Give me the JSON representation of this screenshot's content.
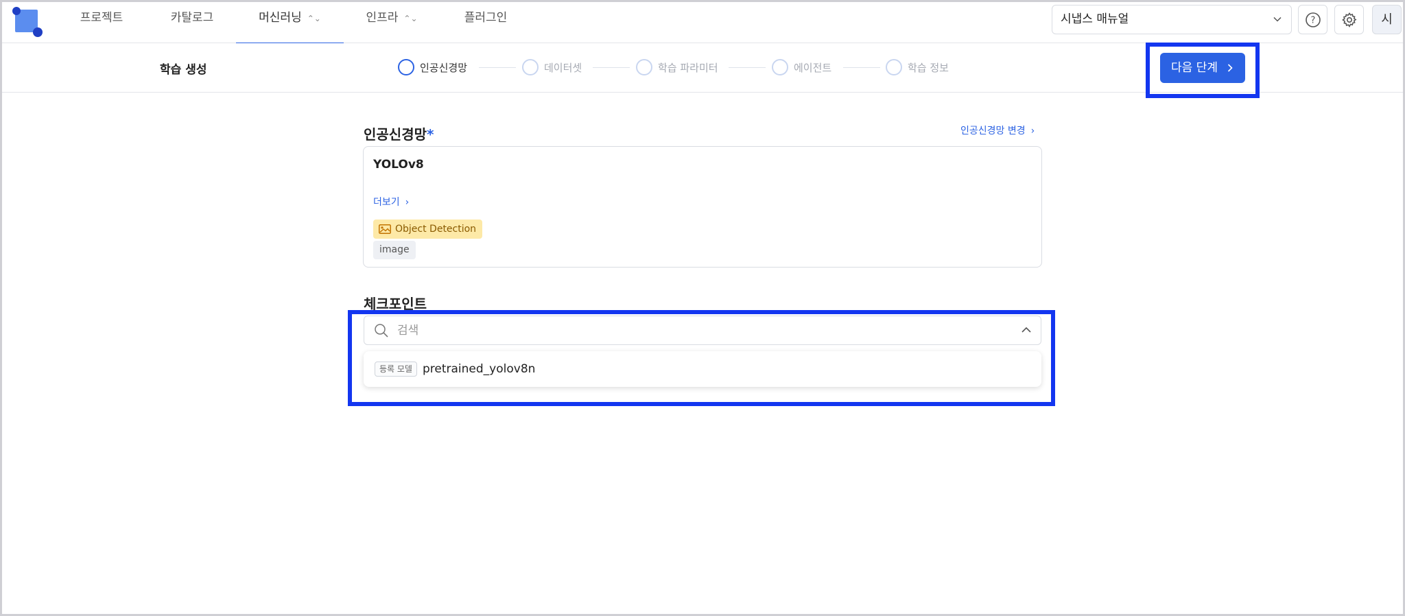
{
  "nav": {
    "items": [
      {
        "label": "프로젝트",
        "has_chevron": false,
        "active": false
      },
      {
        "label": "카탈로그",
        "has_chevron": false,
        "active": false
      },
      {
        "label": "머신러닝",
        "has_chevron": true,
        "active": true
      },
      {
        "label": "인프라",
        "has_chevron": true,
        "active": false
      },
      {
        "label": "플러그인",
        "has_chevron": false,
        "active": false
      }
    ],
    "manual_select": "시냅스 매뉴얼",
    "help_icon": "help-circle-icon",
    "settings_icon": "gear-icon",
    "avatar": "시"
  },
  "stepbar": {
    "title": "학습 생성",
    "steps": [
      {
        "label": "인공신경망",
        "active": true
      },
      {
        "label": "데이터셋",
        "active": false
      },
      {
        "label": "학습 파라미터",
        "active": false
      },
      {
        "label": "에이전트",
        "active": false
      },
      {
        "label": "학습 정보",
        "active": false
      }
    ],
    "next_button": "다음 단계"
  },
  "network": {
    "label": "인공신경망",
    "required_mark": "*",
    "change_link": "인공신경망 변경",
    "model_name": "YOLOv8",
    "more_link": "더보기",
    "task_badge": "Object Detection",
    "type_badge": "image"
  },
  "checkpoint": {
    "label": "체크포인트",
    "search_placeholder": "검색",
    "options": [
      {
        "badge": "등록 모델",
        "label": "pretrained_yolov8n"
      }
    ]
  },
  "colors": {
    "accent": "#2b62e3",
    "highlight": "#1336f0",
    "badge_bg": "#fde9a7"
  }
}
